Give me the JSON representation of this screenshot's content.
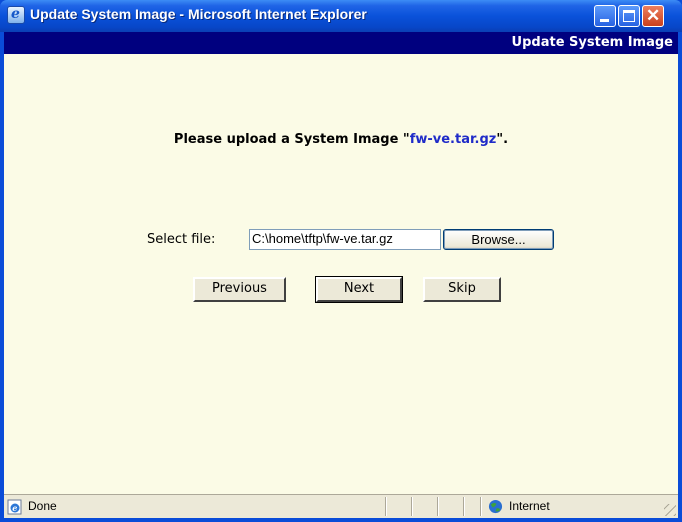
{
  "window": {
    "title": "Update System Image - Microsoft Internet Explorer",
    "app_icon": "ie-icon",
    "controls": {
      "minimize": "minimize-icon",
      "maximize": "maximize-icon",
      "close": "close-icon"
    }
  },
  "page": {
    "header_title": "Update System Image",
    "prompt_prefix": "Please upload a System Image \"",
    "prompt_filename": "fw-ve.tar.gz",
    "prompt_suffix": "\".",
    "file_label": "Select file:",
    "file_value": "C:\\home\\tftp\\fw-ve.tar.gz",
    "browse_label": "Browse...",
    "buttons": {
      "previous": "Previous",
      "next": "Next",
      "skip": "Skip"
    }
  },
  "status": {
    "text": "Done",
    "zone": "Internet",
    "page_icon": "ie-page-icon",
    "zone_icon": "globe-icon"
  },
  "colors": {
    "header_bg": "#00007f",
    "content_bg": "#fbfbe6",
    "filename": "#1f2bc8",
    "titlebar": "#0a52da"
  }
}
